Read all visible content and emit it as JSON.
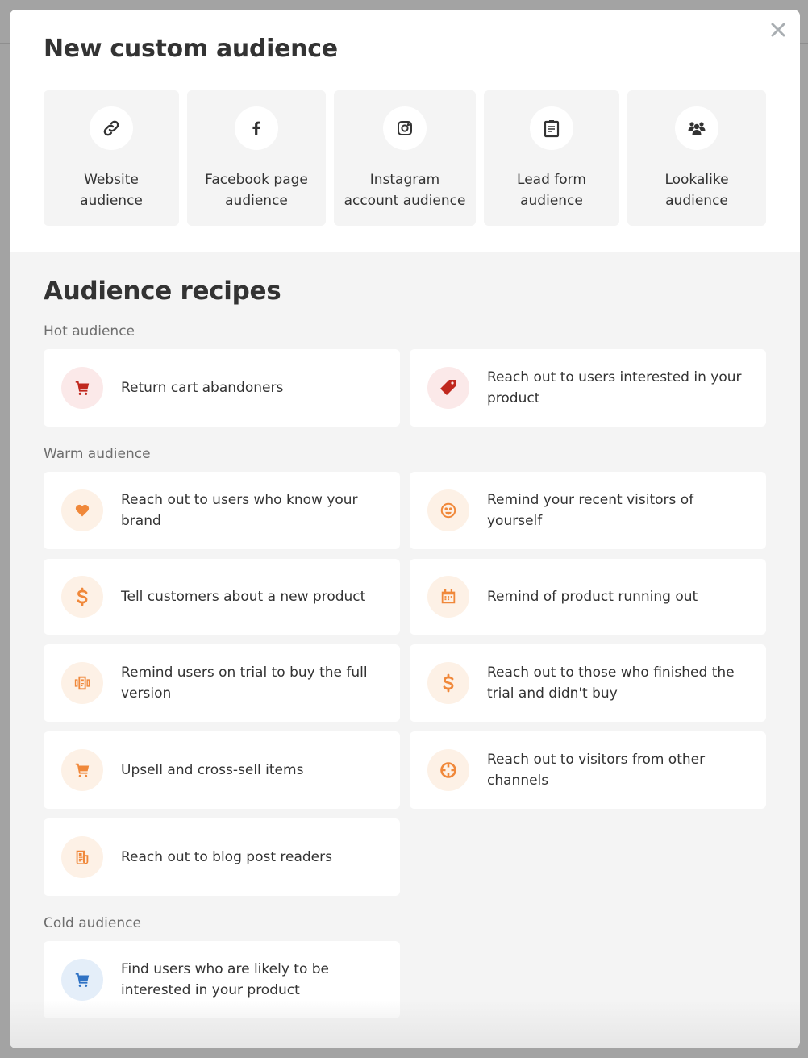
{
  "modal": {
    "title": "New custom audience",
    "close_label": "close"
  },
  "audience_types": [
    {
      "label": "Website\naudience",
      "icon": "link-icon"
    },
    {
      "label": "Facebook page\naudience",
      "icon": "facebook-icon"
    },
    {
      "label": "Instagram\naccount audience",
      "icon": "instagram-icon"
    },
    {
      "label": "Lead form\naudience",
      "icon": "clipboard-icon"
    },
    {
      "label": "Lookalike\naudience",
      "icon": "users-icon"
    }
  ],
  "recipes": {
    "title": "Audience recipes",
    "colors": {
      "hot": "#c0281e",
      "warm": "#f0883a",
      "cold": "#2f72c4"
    },
    "groups": [
      {
        "label": "Hot audience",
        "items": [
          {
            "text": "Return cart abandoners",
            "icon": "cart-icon"
          },
          {
            "text": "Reach out to users interested in your product",
            "icon": "tag-icon"
          }
        ]
      },
      {
        "label": "Warm audience",
        "items": [
          {
            "text": "Reach out to users who know your brand",
            "icon": "heart-icon"
          },
          {
            "text": "Remind your recent visitors of yourself",
            "icon": "smiley-icon"
          },
          {
            "text": "Tell customers about a new product",
            "icon": "dollar-icon"
          },
          {
            "text": "Remind of product running out",
            "icon": "calendar-icon"
          },
          {
            "text": "Remind users on trial to buy the full version",
            "icon": "trial-icon"
          },
          {
            "text": "Reach out to those who finished the trial and didn't buy",
            "icon": "dollar-icon"
          },
          {
            "text": "Upsell and cross-sell items",
            "icon": "cart-icon"
          },
          {
            "text": "Reach out to visitors from other channels",
            "icon": "crosshair-icon"
          },
          {
            "text": "Reach out to blog post readers",
            "icon": "newspaper-icon"
          }
        ]
      },
      {
        "label": "Cold audience",
        "items": [
          {
            "text": "Find users who are likely to be interested in your product",
            "icon": "cart-icon"
          }
        ]
      }
    ]
  }
}
